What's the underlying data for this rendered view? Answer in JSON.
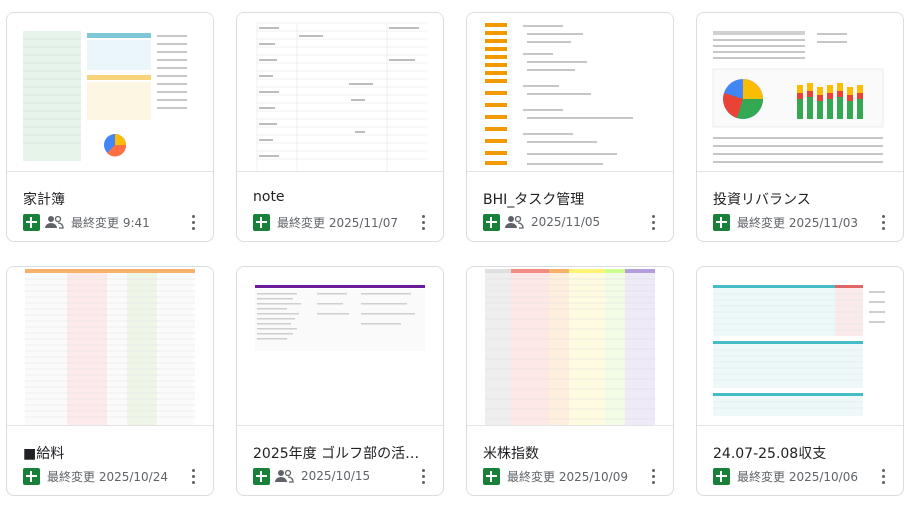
{
  "files": [
    {
      "title": "家計簿",
      "modified": "最終変更 9:41",
      "shared": true
    },
    {
      "title": "note",
      "modified": "最終変更 2025/11/07",
      "shared": false
    },
    {
      "title": "BHI_タスク管理",
      "modified": "2025/11/05",
      "shared": true
    },
    {
      "title": "投資リバランス",
      "modified": "最終変更 2025/11/03",
      "shared": false
    },
    {
      "title": "■給料",
      "modified": "最終変更 2025/10/24",
      "shared": false
    },
    {
      "title": "2025年度 ゴルフ部の活動...",
      "modified": "2025/10/15",
      "shared": true
    },
    {
      "title": "米株指数",
      "modified": "最終変更 2025/10/09",
      "shared": false
    },
    {
      "title": "24.07-25.08収支",
      "modified": "最終変更 2025/10/06",
      "shared": false
    }
  ],
  "icons": {
    "file_type": "google-sheets-icon",
    "shared": "people-icon",
    "more": "more-vert-icon"
  },
  "colors": {
    "sheets_green": "#188038",
    "border": "#dadce0",
    "meta_text": "#5f6368"
  }
}
